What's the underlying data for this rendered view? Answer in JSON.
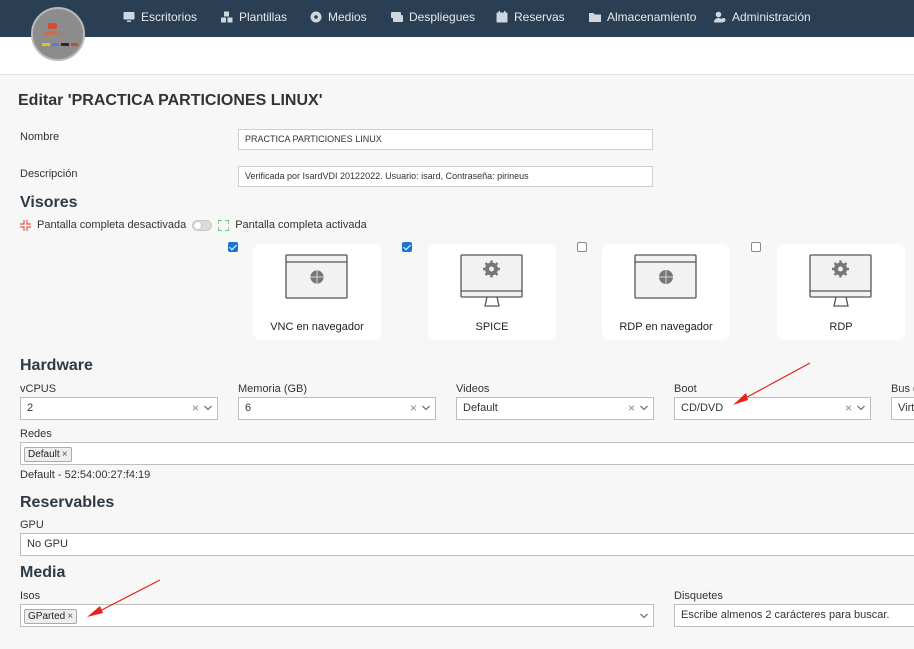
{
  "nav": {
    "items": [
      {
        "label": "Escritorios",
        "icon": "monitor-icon"
      },
      {
        "label": "Plantillas",
        "icon": "cubes-icon"
      },
      {
        "label": "Medios",
        "icon": "disc-icon"
      },
      {
        "label": "Despliegues",
        "icon": "stack-icon"
      },
      {
        "label": "Reservas",
        "icon": "calendar-icon"
      },
      {
        "label": "Almacenamiento",
        "icon": "folder-icon"
      },
      {
        "label": "Administración",
        "icon": "user-gear-icon"
      }
    ]
  },
  "page": {
    "title": "Editar 'PRACTICA PARTICIONES LINUX'"
  },
  "form": {
    "name_label": "Nombre",
    "name_value": "PRACTICA PARTICIONES LINUX",
    "description_label": "Descripción",
    "description_value": "Verificada por IsardVDI 20122022. Usuario: isard, Contraseña: pirineus"
  },
  "viewers": {
    "title": "Visores",
    "fullscreen_off": "Pantalla completa desactivada",
    "fullscreen_on": "Pantalla completa activada",
    "items": [
      {
        "label": "VNC en navegador",
        "checked": true,
        "icon": "browser-globe-icon"
      },
      {
        "label": "SPICE",
        "checked": true,
        "icon": "monitor-gear-icon"
      },
      {
        "label": "RDP en navegador",
        "checked": false,
        "icon": "browser-globe-icon"
      },
      {
        "label": "RDP",
        "checked": false,
        "icon": "monitor-gear-icon"
      }
    ]
  },
  "hardware": {
    "title": "Hardware",
    "vcpus_label": "vCPUS",
    "vcpus_value": "2",
    "memory_label": "Memoria (GB)",
    "memory_value": "6",
    "videos_label": "Videos",
    "videos_value": "Default",
    "boot_label": "Boot",
    "boot_value": "CD/DVD",
    "bus_label": "Bus d",
    "bus_value": "Virt",
    "networks_label": "Redes",
    "network_tag": "Default",
    "network_info": "Default - 52:54:00:27:f4:19"
  },
  "reservables": {
    "title": "Reservables",
    "gpu_label": "GPU",
    "gpu_value": "No GPU"
  },
  "media": {
    "title": "Media",
    "isos_label": "Isos",
    "iso_tag": "GParted",
    "floppy_label": "Disquetes",
    "floppy_placeholder": "Escribe almenos 2 carácteres para buscar."
  },
  "colors": {
    "nav_bg": "#2a3f54",
    "checkbox_on": "#1976d2",
    "annotation_arrow": "#e8221b"
  }
}
